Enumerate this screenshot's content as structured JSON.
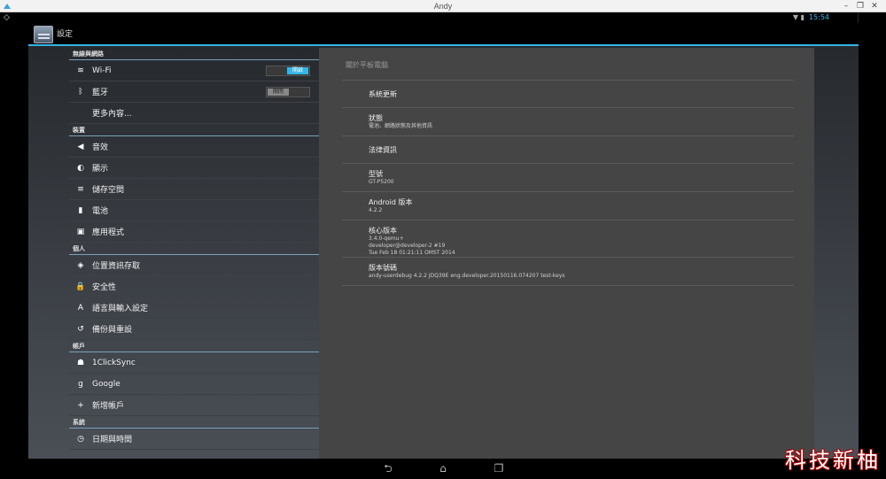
{
  "window": {
    "title": "Andy"
  },
  "statusbar": {
    "time": "15:54"
  },
  "actionbar": {
    "title": "設定"
  },
  "sections": [
    {
      "header": "無線與網路",
      "items": [
        {
          "label": "Wi-Fi",
          "icon": "wifi-icon",
          "glyph": "≋",
          "toggle": "開啟",
          "toggle_state": "on"
        },
        {
          "label": "藍牙",
          "icon": "bluetooth-icon",
          "glyph": "ᛒ",
          "toggle": "關閉",
          "toggle_state": "off"
        },
        {
          "label": "更多內容...",
          "icon": "",
          "glyph": ""
        }
      ]
    },
    {
      "header": "裝置",
      "items": [
        {
          "label": "音效",
          "icon": "speaker-icon",
          "glyph": "◀"
        },
        {
          "label": "顯示",
          "icon": "brightness-icon",
          "glyph": "◐"
        },
        {
          "label": "儲存空間",
          "icon": "storage-icon",
          "glyph": "≡"
        },
        {
          "label": "電池",
          "icon": "battery-icon",
          "glyph": "▮"
        },
        {
          "label": "應用程式",
          "icon": "apps-icon",
          "glyph": "▣"
        }
      ]
    },
    {
      "header": "個人",
      "items": [
        {
          "label": "位置資訊存取",
          "icon": "location-icon",
          "glyph": "◈"
        },
        {
          "label": "安全性",
          "icon": "lock-icon",
          "glyph": "🔒"
        },
        {
          "label": "語言與輸入設定",
          "icon": "keyboard-icon",
          "glyph": "A"
        },
        {
          "label": "備份與重設",
          "icon": "restore-icon",
          "glyph": "↺"
        }
      ]
    },
    {
      "header": "帳戶",
      "items": [
        {
          "label": "1ClickSync",
          "icon": "android-icon",
          "glyph": "☗"
        },
        {
          "label": "Google",
          "icon": "google-icon",
          "glyph": "g"
        },
        {
          "label": "新增帳戶",
          "icon": "plus-icon",
          "glyph": "+"
        }
      ]
    },
    {
      "header": "系統",
      "items": [
        {
          "label": "日期與時間",
          "icon": "clock-icon",
          "glyph": "◷"
        }
      ]
    }
  ],
  "detail": {
    "title": "關於平板電腦",
    "items": [
      {
        "title": "系統更新",
        "lines": []
      },
      {
        "title": "狀態",
        "lines": [
          "電池、網路狀態及其他資訊"
        ]
      },
      {
        "title": "法律資訊",
        "lines": []
      },
      {
        "title": "型號",
        "lines": [
          "GT-P5200"
        ]
      },
      {
        "title": "Android 版本",
        "lines": [
          "4.2.2"
        ]
      },
      {
        "title": "核心版本",
        "lines": [
          "3.4.0-qemu+",
          "developer@developer-2 #19",
          "Tue Feb 18 01:21:11 OMST 2014"
        ]
      },
      {
        "title": "版本號碼",
        "lines": [
          "andy-userdebug 4.2.2 JDQ39E eng.developer.20150116.074207 test-keys"
        ]
      }
    ]
  },
  "navbar": {
    "back": "back-icon",
    "home": "home-icon",
    "recents": "recents-icon"
  },
  "watermark": "科技新柚"
}
